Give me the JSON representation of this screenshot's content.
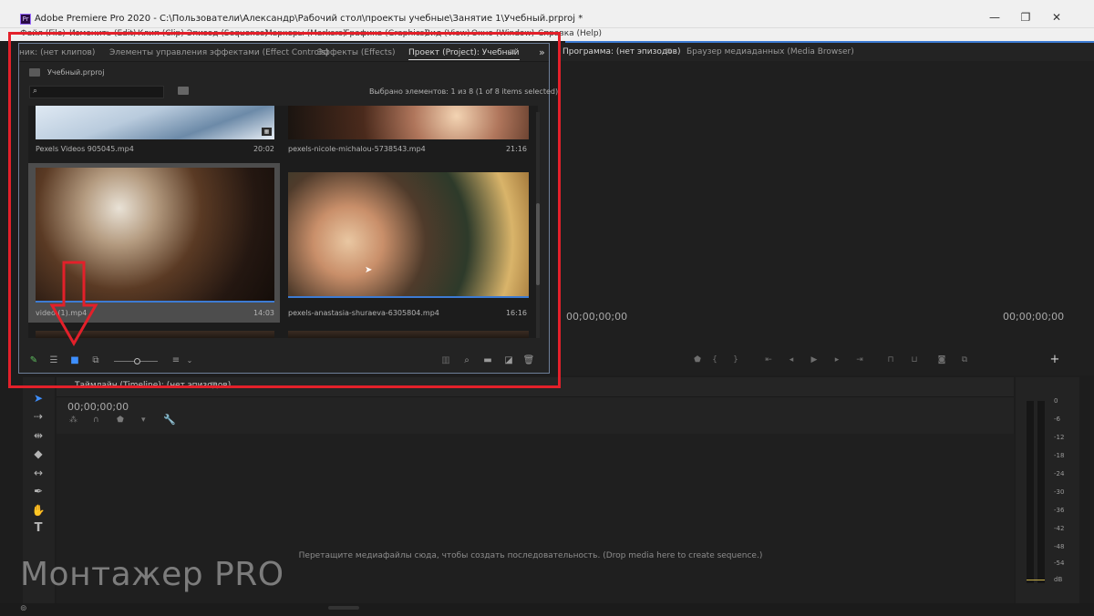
{
  "window": {
    "title": "Adobe Premiere Pro 2020 - C:\\Пользователи\\Александр\\Рабочий стол\\проекты учебные\\Занятие 1\\Учебный.prproj *",
    "app_icon": "Pr",
    "minimize_glyph": "—",
    "maximize_glyph": "❐",
    "close_glyph": "✕"
  },
  "menu": [
    "Файл (File)",
    "Изменить (Edit)",
    "Клип (Clip)",
    "Эпизод (Sequence)",
    "Маркеры (Markers)",
    "Графика (Graphics)",
    "Вид (View)",
    "Окно (Window)",
    "Справка (Help)"
  ],
  "project_panel": {
    "tabs": [
      "ник: (нет клипов)",
      "Элементы управления эффектами (Effect Controls)",
      "Эффекты (Effects)",
      "Проект (Project): Учебный"
    ],
    "tab_menu_glyph": "≡",
    "overflow_glyph": "»",
    "project_file": "Учебный.prproj",
    "selection_info": "Выбрано элементов: 1 из 8 (1 of 8 items selected)",
    "clips": [
      {
        "name": "Pexels Videos 905045.mp4",
        "duration": "20:02"
      },
      {
        "name": "pexels-nicole-michalou-5738543.mp4",
        "duration": "21:16"
      },
      {
        "name": "video (1).mp4",
        "duration": "14:03"
      },
      {
        "name": "pexels-anastasia-shuraeva-6305804.mp4",
        "duration": "16:16"
      }
    ],
    "first_row_partial_names": [
      "video (1).mp4"
    ],
    "visible_clip_label_selected": "video (1).mp4"
  },
  "program_monitor": {
    "tab": "Программа: (нет эпизодов)",
    "tab_menu_glyph": "≡",
    "media_browser_tab": "Браузер медиаданных (Media Browser)",
    "timecode_left": "00;00;00;00",
    "timecode_right": "00;00;00;00",
    "add_button": "+"
  },
  "timeline": {
    "tab": "Таймлайн (Timeline): (нет эпизодов)",
    "tab_menu_glyph": "≡",
    "timecode": "00;00;00;00",
    "drop_message": "Перетащите медиафайлы сюда, чтобы создать последовательность. (Drop media here to create sequence.)"
  },
  "audio_meter": {
    "scale": [
      "0",
      "-6",
      "-12",
      "-18",
      "-24",
      "-30",
      "-36",
      "-42",
      "-48",
      "-54",
      "dB"
    ]
  },
  "watermark": "Монтажер PRO",
  "colors": {
    "highlight_red": "#e3202a",
    "accent_blue": "#3d7bd3",
    "panel_bg": "#232323"
  }
}
